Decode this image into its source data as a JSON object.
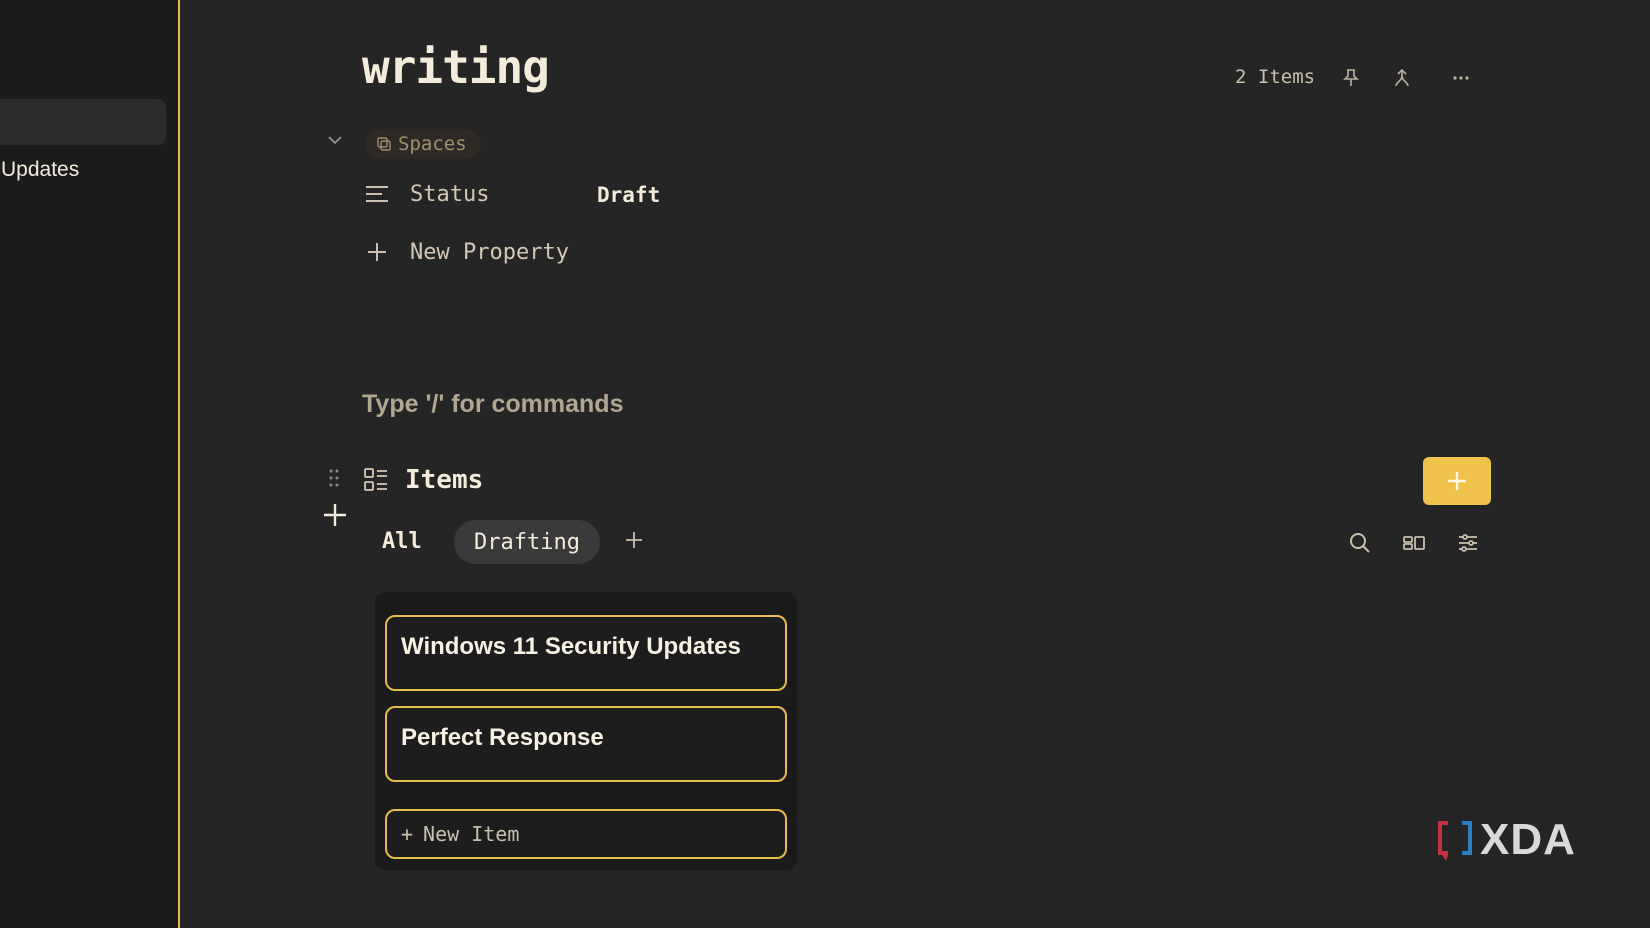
{
  "sidebar": {
    "item_label": "Updates"
  },
  "page": {
    "title": "writing"
  },
  "header": {
    "items_count": "2 Items",
    "pin_icon": "pin-icon",
    "share_icon": "share-icon",
    "more_icon": "more-icon"
  },
  "properties": {
    "spaces_label": "Spaces",
    "status_label": "Status",
    "status_value": "Draft",
    "new_property_label": "New Property"
  },
  "editor": {
    "command_hint": "Type '/' for commands"
  },
  "items_block": {
    "title": "Items",
    "tabs": [
      {
        "label": "All"
      },
      {
        "label": "Drafting"
      }
    ],
    "cards": [
      {
        "title": "Windows 11 Security Updates"
      },
      {
        "title": "Perfect Response"
      }
    ],
    "new_item_label": "New Item",
    "new_item_prefix": "+"
  },
  "watermark": {
    "text": "XDA"
  },
  "colors": {
    "accent": "#e9b949",
    "add_button": "#efc24c",
    "background": "#252525",
    "sidebar": "#1c1c1c"
  }
}
